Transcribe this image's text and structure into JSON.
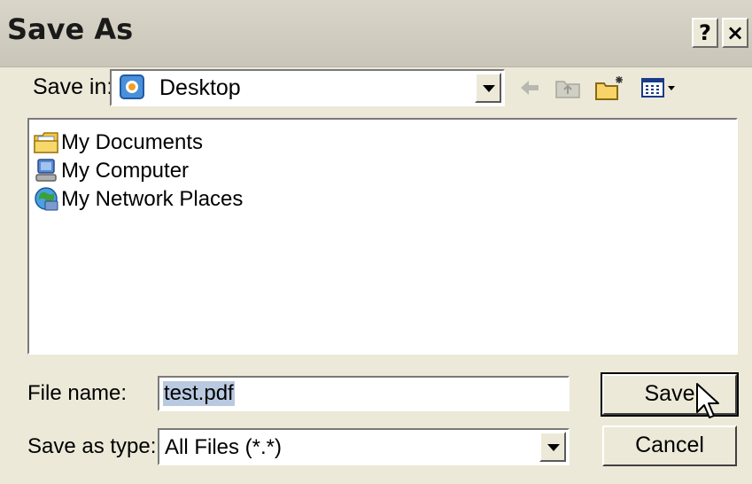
{
  "window": {
    "title": "Save As",
    "help_label": "?",
    "close_label": "×"
  },
  "save_in": {
    "label": "Save in:",
    "value": "Desktop"
  },
  "toolbar": {
    "icons": [
      "back-arrow-icon",
      "up-folder-icon",
      "new-folder-icon",
      "view-menu-icon"
    ]
  },
  "files": [
    {
      "name": "My Documents",
      "icon": "my-documents-icon"
    },
    {
      "name": "My Computer",
      "icon": "my-computer-icon"
    },
    {
      "name": "My Network Places",
      "icon": "my-network-places-icon"
    }
  ],
  "file_name": {
    "label": "File name:",
    "value": "test.pdf"
  },
  "save_as_type": {
    "label": "Save as type:",
    "value": "All Files (*.*)"
  },
  "buttons": {
    "save": "Save",
    "cancel": "Cancel"
  }
}
